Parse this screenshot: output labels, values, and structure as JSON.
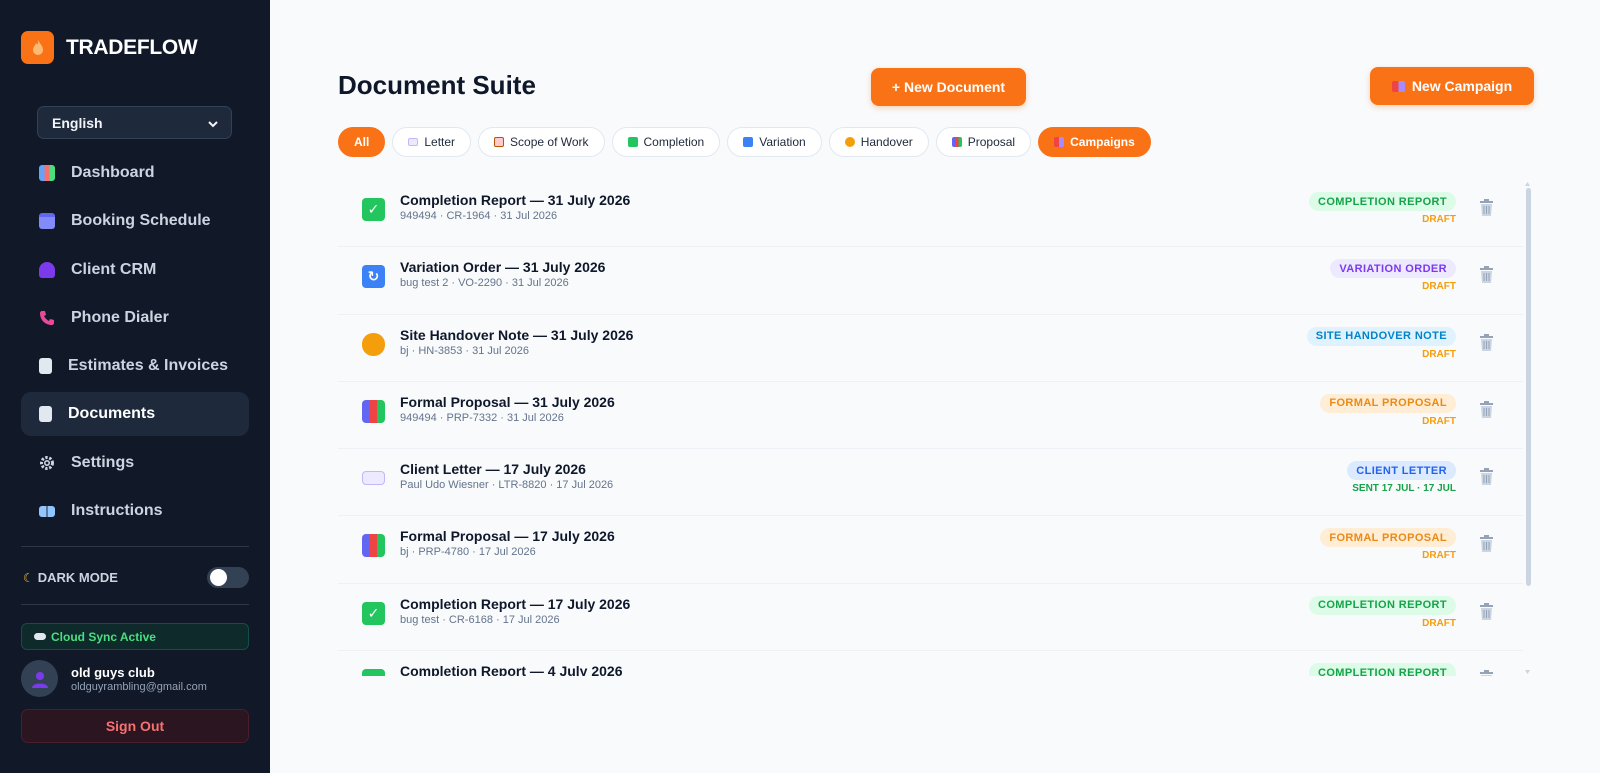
{
  "brand": {
    "name": "TRADEFLOW",
    "logo_color": "#f97316"
  },
  "language": {
    "selected": "English"
  },
  "nav": [
    {
      "label": "Dashboard",
      "icon": "chart-icon",
      "active": false
    },
    {
      "label": "Booking Schedule",
      "icon": "calendar-icon",
      "active": false
    },
    {
      "label": "Client CRM",
      "icon": "users-icon",
      "active": false
    },
    {
      "label": "Phone Dialer",
      "icon": "phone-icon",
      "active": false
    },
    {
      "label": "Estimates & Invoices",
      "icon": "invoice-icon",
      "active": false
    },
    {
      "label": "Documents",
      "icon": "document-icon",
      "active": true
    },
    {
      "label": "Settings",
      "icon": "gear-icon",
      "active": false
    },
    {
      "label": "Instructions",
      "icon": "book-icon",
      "active": false
    }
  ],
  "dark_mode": {
    "label": "DARK MODE",
    "enabled": false
  },
  "sync": {
    "label": "Cloud Sync Active"
  },
  "user": {
    "name": "old guys club",
    "email": "oldguyrambling@gmail.com"
  },
  "sign_out": "Sign Out",
  "page": {
    "title": "Document Suite",
    "new_document": "+ New Document",
    "new_campaign": "New Campaign"
  },
  "filters": [
    {
      "label": "All",
      "icon": "",
      "selected": true
    },
    {
      "label": "Letter",
      "icon": "envelope-icon",
      "selected": false
    },
    {
      "label": "Scope of Work",
      "icon": "clipboard-icon",
      "selected": false
    },
    {
      "label": "Completion",
      "icon": "checkmark-icon",
      "selected": false
    },
    {
      "label": "Variation",
      "icon": "refresh-icon",
      "selected": false
    },
    {
      "label": "Handover",
      "icon": "handshake-icon",
      "selected": false
    },
    {
      "label": "Proposal",
      "icon": "chart-icon",
      "selected": false
    },
    {
      "label": "Campaigns",
      "icon": "megaphone-icon",
      "selected": true
    }
  ],
  "documents": [
    {
      "title": "Completion Report — 31 July 2026",
      "meta": "949494 · CR-1964 · 31 Jul 2026",
      "type": "COMPLETION REPORT",
      "status": "DRAFT",
      "kind": "completion"
    },
    {
      "title": "Variation Order — 31 July 2026",
      "meta": "bug test 2 · VO-2290 · 31 Jul 2026",
      "type": "VARIATION ORDER",
      "status": "DRAFT",
      "kind": "variation"
    },
    {
      "title": "Site Handover Note — 31 July 2026",
      "meta": "bj · HN-3853 · 31 Jul 2026",
      "type": "SITE HANDOVER NOTE",
      "status": "DRAFT",
      "kind": "handover"
    },
    {
      "title": "Formal Proposal — 31 July 2026",
      "meta": "949494 · PRP-7332 · 31 Jul 2026",
      "type": "FORMAL PROPOSAL",
      "status": "DRAFT",
      "kind": "proposal"
    },
    {
      "title": "Client Letter — 17 July 2026",
      "meta": "Paul Udo Wiesner · LTR-8820 · 17 Jul 2026",
      "type": "CLIENT LETTER",
      "status": "SENT 17 JUL · 17 JUL",
      "kind": "letter"
    },
    {
      "title": "Formal Proposal — 17 July 2026",
      "meta": "bj · PRP-4780 · 17 Jul 2026",
      "type": "FORMAL PROPOSAL",
      "status": "DRAFT",
      "kind": "proposal"
    },
    {
      "title": "Completion Report — 17 July 2026",
      "meta": "bug test · CR-6168 · 17 Jul 2026",
      "type": "COMPLETION REPORT",
      "status": "DRAFT",
      "kind": "completion"
    },
    {
      "title": "Completion Report — 4 July 2026",
      "meta": "",
      "type": "COMPLETION REPORT",
      "status": "",
      "kind": "completion"
    }
  ],
  "colors": {
    "accent": "#f97316",
    "completion": {
      "bg": "#dcfce7",
      "fg": "#16a34a",
      "icon": "#22c55e"
    },
    "variation": {
      "bg": "#ede9fe",
      "fg": "#7c3aed",
      "icon": "#3b82f6"
    },
    "handover": {
      "bg": "#e0f2fe",
      "fg": "#0284c7",
      "icon": "#f59e0b"
    },
    "proposal": {
      "bg": "#ffedd5",
      "fg": "#ea8a17",
      "icon": "#6366f1"
    },
    "letter": {
      "bg": "#dbeafe",
      "fg": "#2563eb",
      "icon": "#c4b5fd"
    },
    "sent": "#16a34a"
  }
}
